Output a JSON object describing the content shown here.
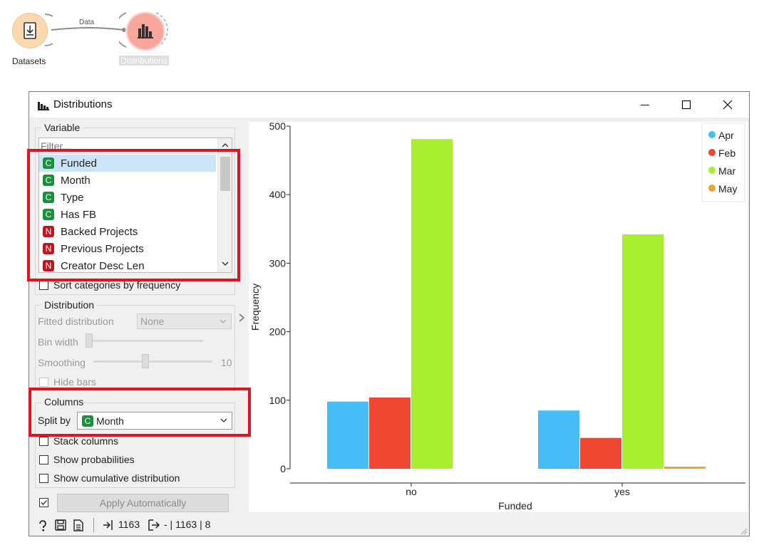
{
  "canvas": {
    "datasets_label": "Datasets",
    "link_label": "Data",
    "distributions_label": "Distributions"
  },
  "window": {
    "title": "Distributions"
  },
  "variable": {
    "group_title": "Variable",
    "filter_placeholder": "Filter...",
    "items": [
      {
        "type": "C",
        "label": "Funded",
        "selected": true
      },
      {
        "type": "C",
        "label": "Month"
      },
      {
        "type": "C",
        "label": "Type"
      },
      {
        "type": "C",
        "label": "Has FB"
      },
      {
        "type": "N",
        "label": "Backed Projects"
      },
      {
        "type": "N",
        "label": "Previous Projects"
      },
      {
        "type": "N",
        "label": "Creator Desc Len"
      }
    ],
    "sort_label": "Sort categories by frequency"
  },
  "distribution": {
    "group_title": "Distribution",
    "fitted_label": "Fitted distribution",
    "fitted_value": "None",
    "bin_width_label": "Bin width",
    "smoothing_label": "Smoothing",
    "smoothing_value": "10",
    "hide_bars_label": "Hide bars"
  },
  "columns": {
    "group_title": "Columns",
    "split_label": "Split by",
    "split_type": "C",
    "split_value": "Month",
    "stack_label": "Stack columns",
    "prob_label": "Show probabilities",
    "cumulative_label": "Show cumulative distribution"
  },
  "apply": {
    "label": "Apply Automatically",
    "checked": true
  },
  "status": {
    "input_count": "1163",
    "output_text": "- | 1163 | 8"
  },
  "colors": {
    "continuous_badge": "#1a8f3c",
    "nominal_badge": "#c0161f",
    "Apr": "#46bdf6",
    "Feb": "#ee4630",
    "Mar": "#a9ee30",
    "May": "#f0a23a"
  },
  "chart_data": {
    "type": "bar",
    "categories": [
      "no",
      "yes"
    ],
    "series": [
      {
        "name": "Apr",
        "values": [
          98,
          85
        ]
      },
      {
        "name": "Feb",
        "values": [
          104,
          45
        ]
      },
      {
        "name": "Mar",
        "values": [
          481,
          342
        ]
      },
      {
        "name": "May",
        "values": [
          0,
          3
        ]
      }
    ],
    "xlabel": "Funded",
    "ylabel": "Frequency",
    "ylim": [
      0,
      500
    ],
    "yticks": [
      0,
      100,
      200,
      300,
      400,
      500
    ],
    "legend_position": "top-right",
    "grid": false
  }
}
